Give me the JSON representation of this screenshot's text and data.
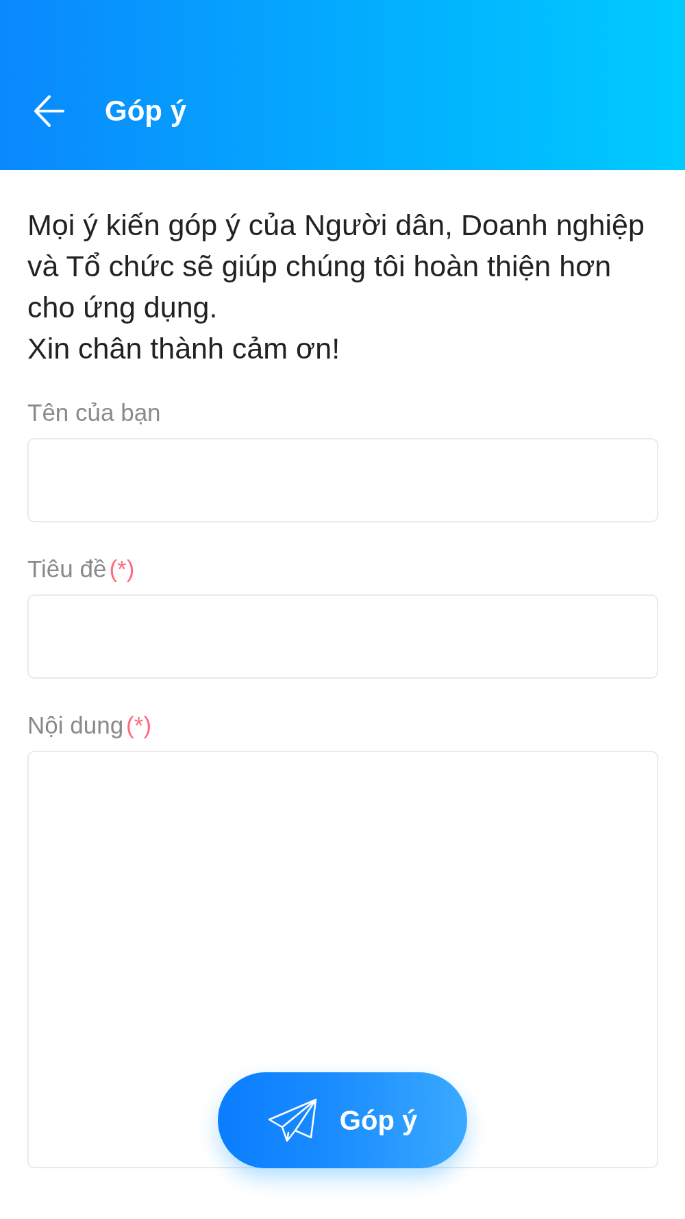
{
  "header": {
    "title": "Góp ý"
  },
  "intro": [
    "Mọi ý kiến góp ý của Người dân, Doanh nghiệp và Tổ chức sẽ giúp chúng tôi hoàn thiện hơn cho ứng dụng.",
    "Xin chân thành cảm ơn!"
  ],
  "fields": [
    {
      "kind": "input",
      "label": "Tên của bạn"
    },
    {
      "kind": "input",
      "label": "Tiêu đề",
      "required_mark": "(*)"
    },
    {
      "kind": "textarea",
      "label": "Nội dung",
      "required_mark": "(*)"
    }
  ],
  "submit_button": {
    "label": "Góp ý"
  }
}
